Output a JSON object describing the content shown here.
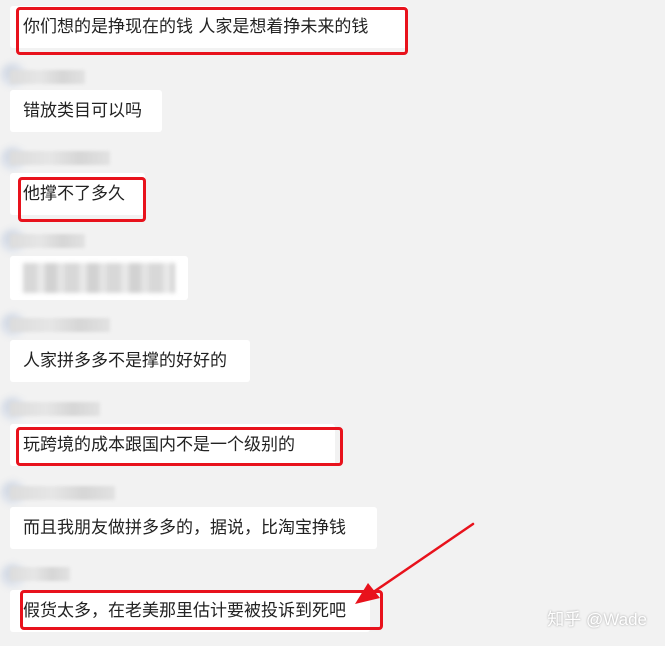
{
  "messages": [
    {
      "text": "你们想的是挣现在的钱  人家是想着挣未来的钱"
    },
    {
      "text": "错放类目可以吗"
    },
    {
      "text": "他撑不了多久"
    },
    {
      "text": ""
    },
    {
      "text": "人家拼多多不是撑的好好的"
    },
    {
      "text": "玩跨境的成本跟国内不是一个级别的"
    },
    {
      "text": "而且我朋友做拼多多的，据说，比淘宝挣钱"
    },
    {
      "text": "假货太多，在老美那里估计要被投诉到死吧"
    }
  ],
  "watermark": "知乎 @Wade",
  "colors": {
    "highlight": "#e8121c",
    "bubble": "#ffffff",
    "background": "#f2f2f2"
  }
}
